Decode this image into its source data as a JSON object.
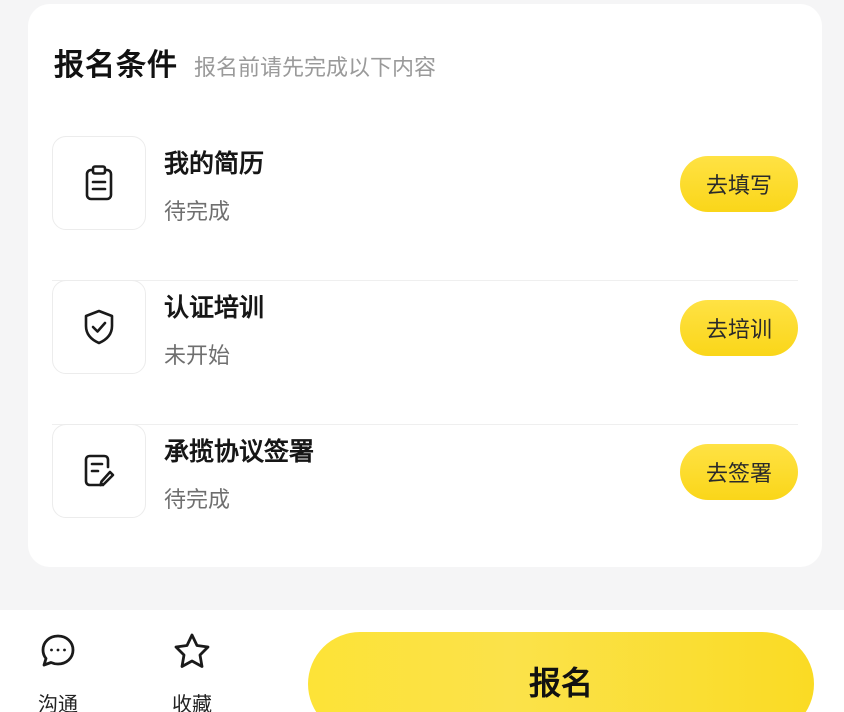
{
  "card": {
    "title": "报名条件",
    "subtitle": "报名前请先完成以下内容"
  },
  "items": [
    {
      "title": "我的简历",
      "status": "待完成",
      "button": "去填写",
      "icon": "clipboard-icon"
    },
    {
      "title": "认证培训",
      "status": "未开始",
      "button": "去培训",
      "icon": "shield-check-icon"
    },
    {
      "title": "承揽协议签署",
      "status": "待完成",
      "button": "去签署",
      "icon": "document-edit-icon"
    }
  ],
  "bottom_bar": {
    "chat_label": "沟通",
    "chat_icon": "chat-bubble-icon",
    "favorite_label": "收藏",
    "favorite_icon": "star-icon",
    "signup_label": "报名"
  },
  "colors": {
    "accent": "#fad619",
    "background": "#f5f5f6",
    "card": "#ffffff"
  }
}
